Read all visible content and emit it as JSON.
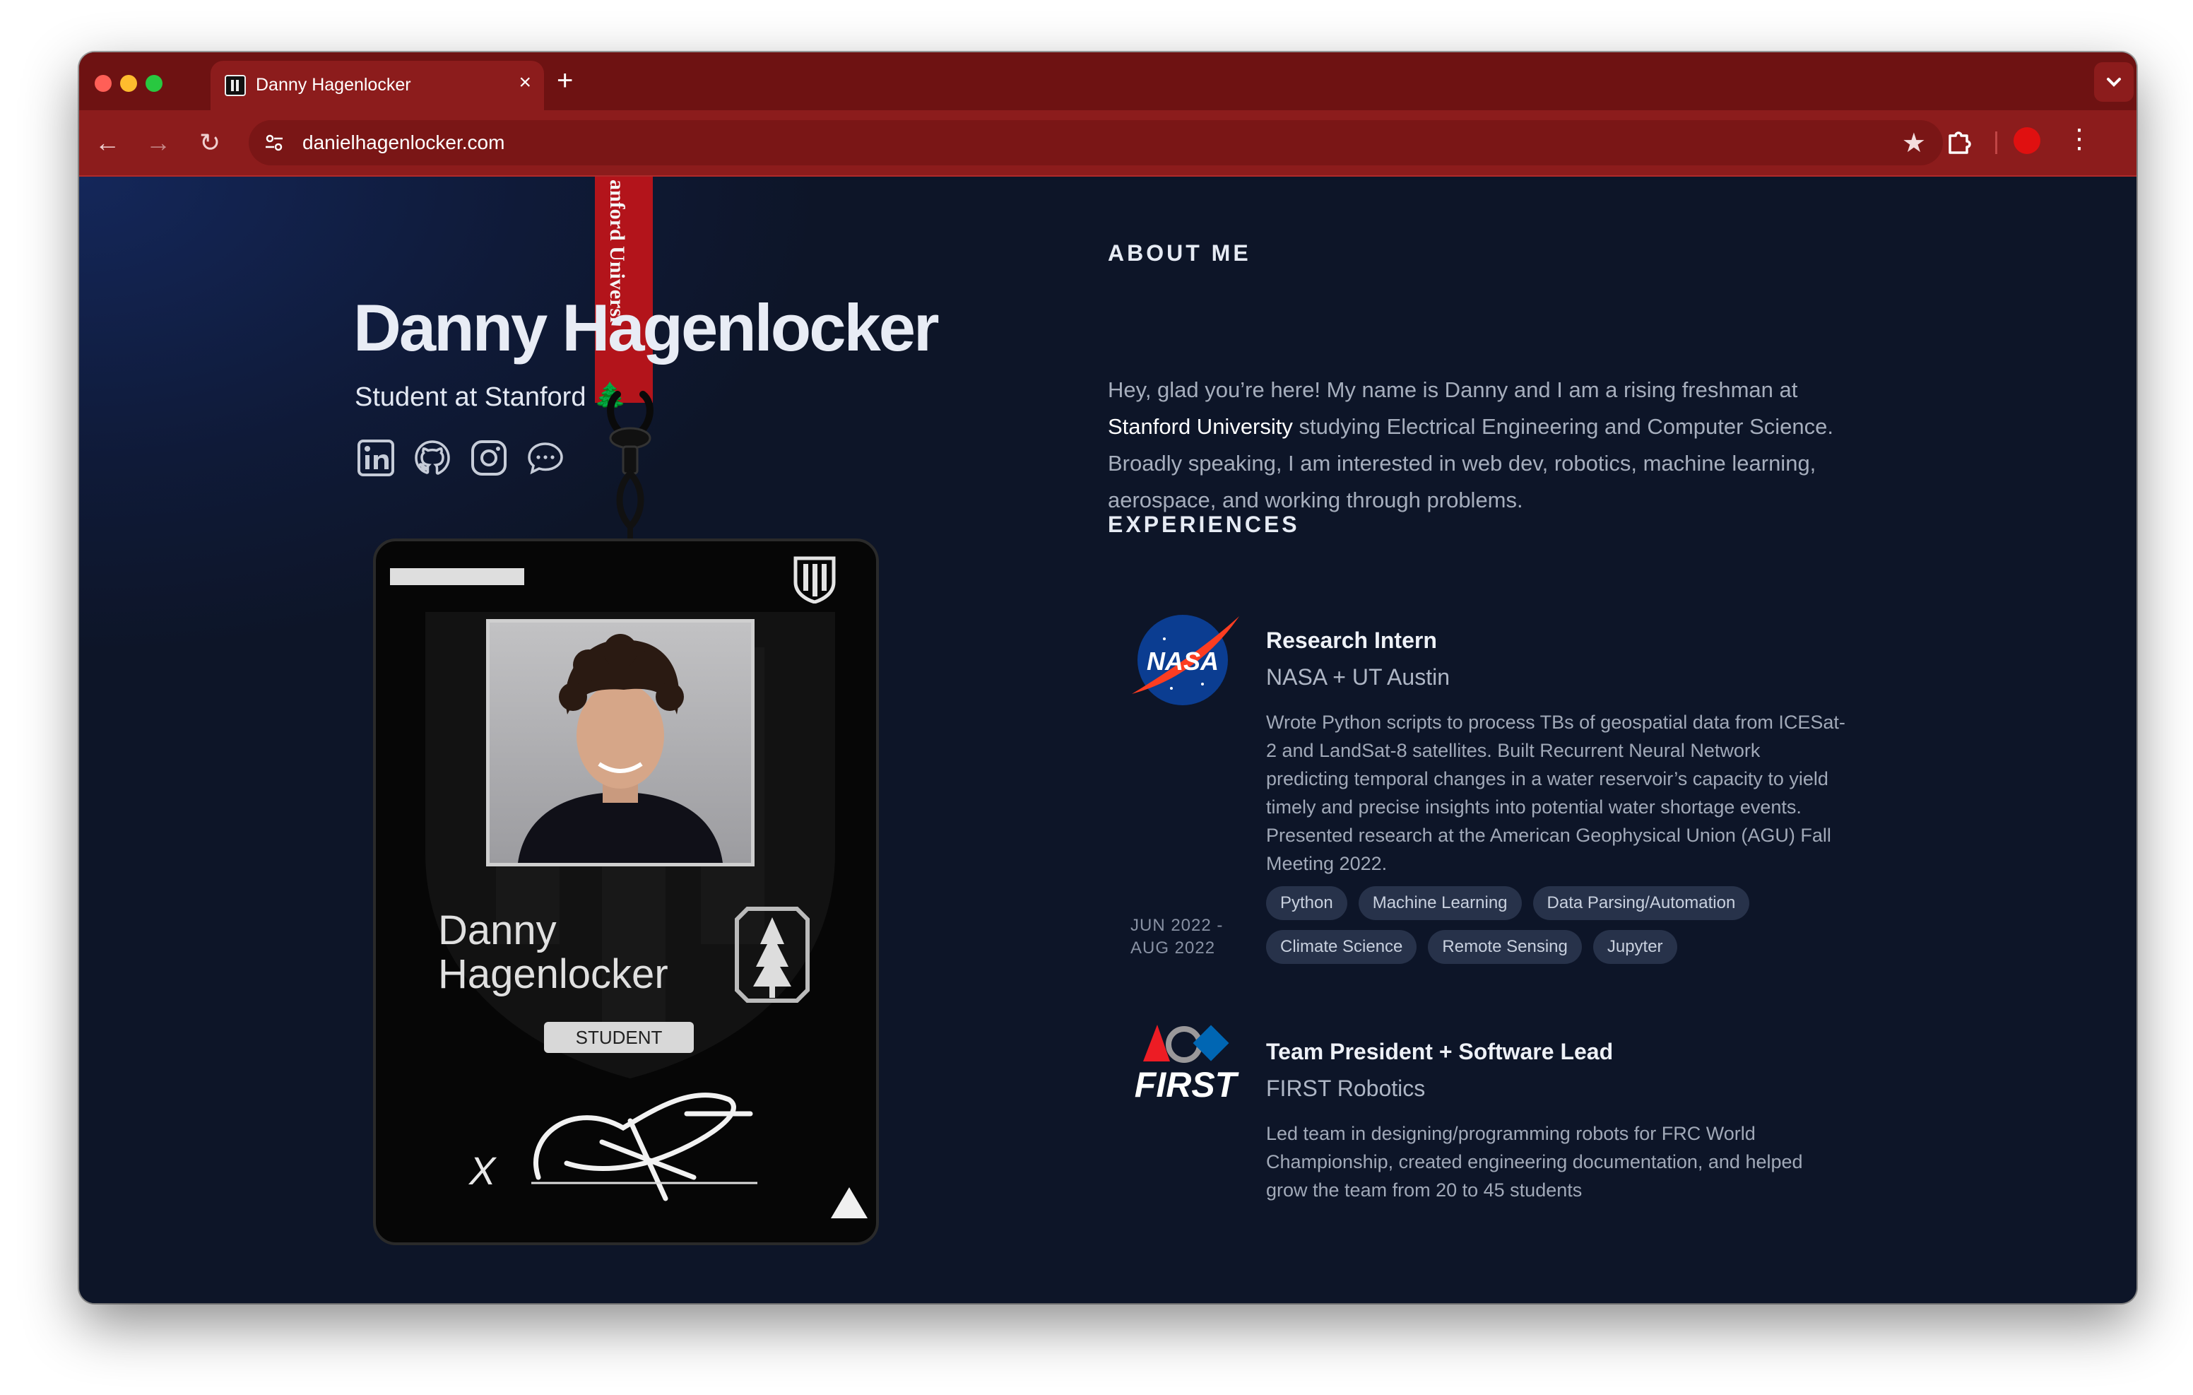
{
  "browser": {
    "tab_title": "Danny Hagenlocker",
    "tab_close": "×",
    "new_tab": "+",
    "url": "danielhagenlocker.com",
    "back": "←",
    "forward": "→",
    "reload": "↻",
    "star": "★",
    "menu": "⋮",
    "accent": "#8c1c1c"
  },
  "hero": {
    "name": "Danny Hagenlocker",
    "subtitle": "Student at Stanford 🌲",
    "lanyard_text": "anford Universi"
  },
  "socials": [
    "linkedin-icon",
    "github-icon",
    "instagram-icon",
    "chat-icon"
  ],
  "badge": {
    "name_line1": "Danny",
    "name_line2": "Hagenlocker",
    "role": "STUDENT",
    "x_mark": "X"
  },
  "about": {
    "heading": "ABOUT ME",
    "text_1": "Hey, glad you’re here! My name is Danny and I am a rising freshman at ",
    "highlight": "Stanford University",
    "text_2": " studying Electrical Engineering and Computer Science. Broadly speaking, I am interested in web dev, robotics, machine learning, aerospace, and working through problems."
  },
  "experiences_heading": "EXPERIENCES",
  "experiences": [
    {
      "logo": "nasa-logo",
      "logo_text": "NASA",
      "title": "Research Intern",
      "org": "NASA + UT Austin",
      "description": "Wrote Python scripts to process TBs of geospatial data from ICESat-2 and LandSat-8 satellites. Built Recurrent Neural Network predicting temporal changes in a water reservoir’s capacity to yield timely and precise insights into potential water shortage events. Presented research at the American Geophysical Union (AGU) Fall Meeting 2022.",
      "date_line1": "JUN 2022 -",
      "date_line2": "AUG 2022",
      "tags": [
        "Python",
        "Machine Learning",
        "Data Parsing/Automation",
        "Climate Science",
        "Remote Sensing",
        "Jupyter"
      ]
    },
    {
      "logo": "first-logo",
      "logo_text": "FIRST",
      "title": "Team President + Software Lead",
      "org": "FIRST Robotics",
      "description": "Led team in designing/programming robots for FRC World Championship, created engineering documentation, and helped grow the team from 20 to 45 students"
    }
  ]
}
